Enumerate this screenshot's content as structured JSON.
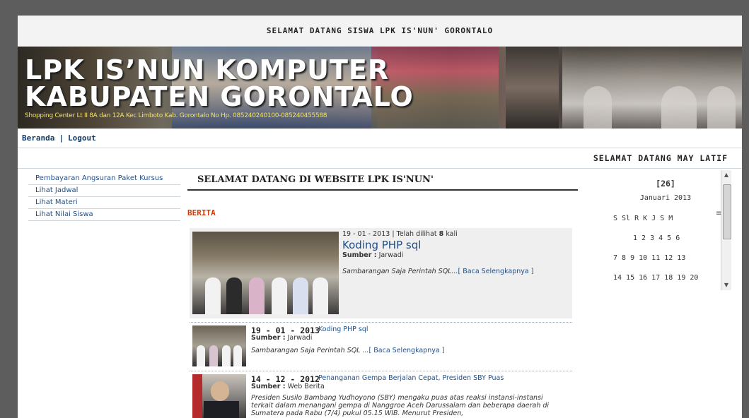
{
  "header": {
    "welcome": "SELAMAT DATANG SISWA LPK IS'NUN' GORONTALO"
  },
  "banner": {
    "title_line1": "LPK IS’NUN KOMPUTER",
    "title_line2": "KABUPATEN GORONTALO",
    "subtitle": "Shopping Center Lt II 8A dan 12A Kec Limboto Kab. Gorontalo No Hp. 085240240100-085240455588"
  },
  "nav": {
    "home": "Beranda",
    "sep": "|",
    "logout": "Logout"
  },
  "greeting": "SELAMAT DATANG MAY LATIF",
  "sidebar": {
    "items": [
      {
        "label": "Pembayaran Angsuran Paket Kursus"
      },
      {
        "label": "Lihat Jadwal"
      },
      {
        "label": "Lihat Materi"
      },
      {
        "label": "Lihat Nilai Siswa"
      }
    ]
  },
  "main": {
    "title": "SELAMAT DATANG DI WEBSITE LPK IS'NUN'",
    "section": "BERITA",
    "featured": {
      "meta_date": "19 - 01 - 2013",
      "meta_sep": "|",
      "meta_prefix": "Telah dilihat",
      "meta_count": "8",
      "meta_suffix": "kali",
      "title": "Koding PHP sql",
      "source_label": "Sumber :",
      "source": "Jarwadi",
      "excerpt": "Sambarangan Saja Perintah SQL...",
      "readmore": "[ Baca Selengkapnya ]"
    },
    "items": [
      {
        "date": "19 - 01 - 2013",
        "title": "Koding PHP sql",
        "source_label": "Sumber :",
        "source": "Jarwadi",
        "excerpt": "Sambarangan Saja Perintah SQL ...",
        "readmore": "[ Baca Selengkapnya ]"
      },
      {
        "date": "14 - 12 - 2012",
        "title": "Penanganan Gempa Berjalan Cepat, Presiden SBY Puas",
        "source_label": "Sumber :",
        "source": "Web Berita",
        "excerpt": "Presiden Susilo Bambang Yudhoyono (SBY) mengaku puas atas reaksi instansi-instansi terkait dalam menangani gempa di Nanggroe Aceh Darussalam dan beberapa daerah di Sumatera pada Rabu (7/4) pukul 05.15 WIB. Menurut Presiden,"
      }
    ]
  },
  "calendar": {
    "day": "[26]",
    "month": "Januari 2013",
    "weekdays": "S Sl R K J S M",
    "rows": [
      "1 2 3 4 5 6",
      "7 8 9 10 11 12 13",
      "14 15 16 17 18 19 20"
    ]
  },
  "colors": {
    "link": "#1f4f8a",
    "accent": "#d33b0b",
    "subtitle": "#f3e15a"
  }
}
